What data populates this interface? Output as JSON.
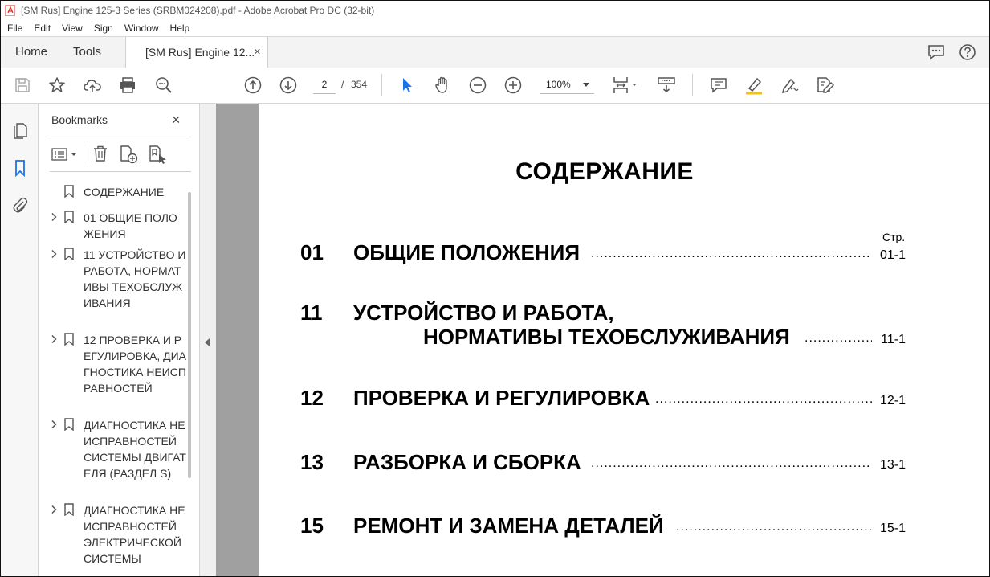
{
  "window": {
    "title": "[SM Rus] Engine 125-3 Series (SRBM024208).pdf - Adobe Acrobat Pro DC (32-bit)"
  },
  "menu": [
    "File",
    "Edit",
    "View",
    "Sign",
    "Window",
    "Help"
  ],
  "tabs": {
    "home": "Home",
    "tools": "Tools",
    "document": "[SM Rus] Engine 12...",
    "close": "×"
  },
  "toolbar": {
    "current_page": "2",
    "page_separator": "/",
    "total_pages": "354",
    "zoom": "100%"
  },
  "bookmarks": {
    "title": "Bookmarks",
    "close": "×",
    "items": [
      {
        "label": "СОДЕРЖАНИЕ",
        "expandable": false
      },
      {
        "label": "01 ОБЩИЕ ПОЛОЖЕНИЯ",
        "expandable": true
      },
      {
        "label": "11 УСТРОЙСТВО И РАБОТА, НОРМАТИВЫ ТЕХОБСЛУЖИВАНИЯ",
        "expandable": true
      },
      {
        "label": "12 ПРОВЕРКА И РЕГУЛИРОВКА, ДИАГНОСТИКА НЕИСПРАВНОСТЕЙ",
        "expandable": true
      },
      {
        "label": "ДИАГНОСТИКА НЕИСПРАВНОСТЕЙ СИСТЕМЫ ДВИГАТЕЛЯ (РАЗДЕЛ S)",
        "expandable": true
      },
      {
        "label": "ДИАГНОСТИКА НЕИСПРАВНОСТЕЙ ЭЛЕКТРИЧЕСКОЙ СИСТЕМЫ",
        "expandable": true
      }
    ]
  },
  "document": {
    "title": "СОДЕРЖАНИЕ",
    "page_col_label": "Стр.",
    "entries": [
      {
        "num": "01",
        "line1": "ОБЩИЕ ПОЛОЖЕНИЯ",
        "line2": "",
        "page": "01-1"
      },
      {
        "num": "11",
        "line1": "УСТРОЙСТВО И РАБОТА,",
        "line2": "НОРМАТИВЫ ТЕХОБСЛУЖИВАНИЯ",
        "page": "11-1"
      },
      {
        "num": "12",
        "line1": "ПРОВЕРКА И РЕГУЛИРОВКА",
        "line2": "",
        "page": "12-1"
      },
      {
        "num": "13",
        "line1": "РАЗБОРКА И СБОРКА",
        "line2": "",
        "page": "13-1"
      },
      {
        "num": "15",
        "line1": "РЕМОНТ И ЗАМЕНА ДЕТАЛЕЙ",
        "line2": "",
        "page": "15-1"
      }
    ]
  },
  "colors": {
    "accent_blue": "#1a73e8",
    "pdf_red": "#d93025"
  }
}
